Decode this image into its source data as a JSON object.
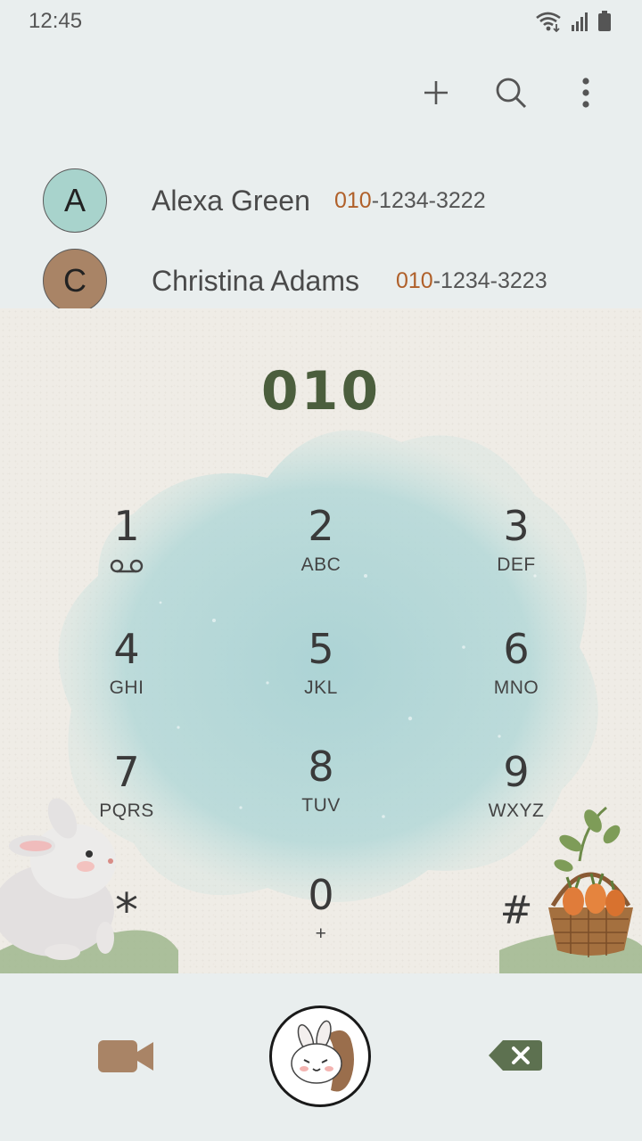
{
  "status_bar": {
    "time": "12:45",
    "icons": [
      "wifi-icon",
      "signal-icon",
      "battery-icon"
    ]
  },
  "action_bar": {
    "icons": [
      "add-icon",
      "search-icon",
      "more-vert-icon"
    ]
  },
  "contacts": [
    {
      "initial": "A",
      "name": "Alexa Green",
      "number_match": "010",
      "number_rest": "-1234-3222",
      "avatar_color": "#a8d3cc"
    },
    {
      "initial": "C",
      "name": "Christina Adams",
      "number_match": "010",
      "number_rest": "-1234-3223",
      "avatar_color": "#a98466"
    }
  ],
  "dialer": {
    "input": "010",
    "keys": [
      {
        "digit": "1",
        "letters": ""
      },
      {
        "digit": "2",
        "letters": "ABC"
      },
      {
        "digit": "3",
        "letters": "DEF"
      },
      {
        "digit": "4",
        "letters": "GHI"
      },
      {
        "digit": "5",
        "letters": "JKL"
      },
      {
        "digit": "6",
        "letters": "MNO"
      },
      {
        "digit": "7",
        "letters": "PQRS"
      },
      {
        "digit": "8",
        "letters": "TUV"
      },
      {
        "digit": "9",
        "letters": "WXYZ"
      },
      {
        "digit": "*",
        "letters": ""
      },
      {
        "digit": "0",
        "letters": "+"
      },
      {
        "digit": "#",
        "letters": ""
      }
    ]
  },
  "bottom_bar": {
    "icons": [
      "video-call-icon",
      "call-bunny-icon",
      "backspace-icon"
    ]
  },
  "colors": {
    "accent_match": "#b0602a",
    "dialed_text": "#4b5e3d",
    "video_icon": "#a98466",
    "backspace_icon": "#5d7150",
    "watercolor": "#a9d2d4"
  }
}
